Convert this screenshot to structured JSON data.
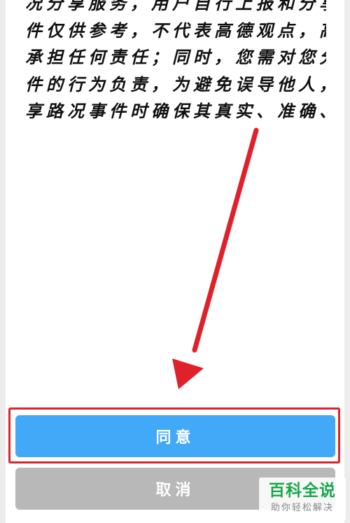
{
  "notice": {
    "lines": [
      "况分享服务，用户自行上报和分享的路况事",
      "件仅供参考，不代表高德观点，高德对此不",
      "承担任何责任；同时，您需对您分享路况事",
      "件的行为负责，为避免误导他人，请您在分",
      "享路况事件时确保其真实、准确、及时。"
    ]
  },
  "buttons": {
    "agree_label": "同意",
    "cancel_label": "取消"
  },
  "annotation": {
    "arrow_color": "#e0202a",
    "highlight_color": "#e0202a"
  },
  "watermark": {
    "title": "百科全说",
    "subtitle": "助你轻松解决"
  },
  "colors": {
    "agree_button": "#41a9f7",
    "cancel_button": "#b8b8b8",
    "watermark_title": "#18a84a"
  }
}
